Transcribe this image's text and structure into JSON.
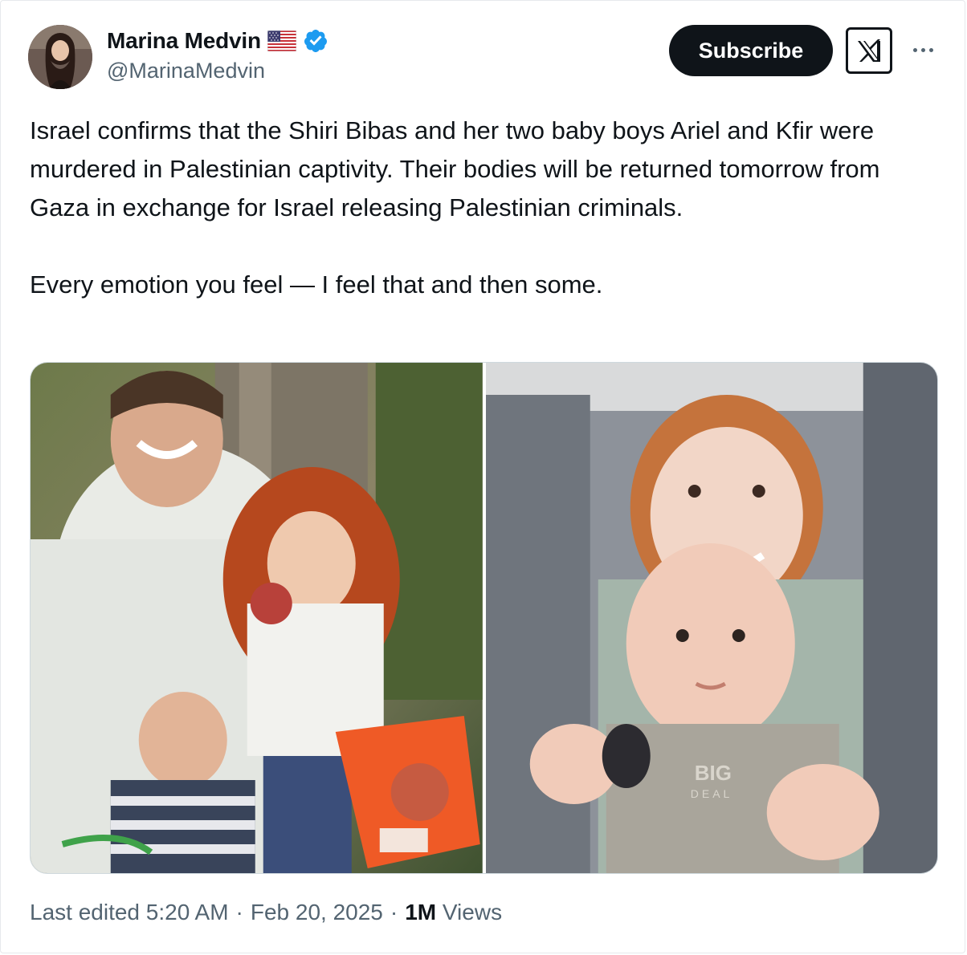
{
  "post": {
    "author": {
      "display_name": "Marina Medvin",
      "handle": "@MarinaMedvin",
      "flag": "us-flag-icon",
      "verified": true,
      "verified_color": "#1d9bf0"
    },
    "subscribe_label": "Subscribe",
    "text": "Israel confirms that the Shiri Bibas and her two baby boys Ariel and Kfir were murdered in Palestinian captivity. Their bodies will be returned tomorrow from Gaza in exchange for Israel releasing Palestinian criminals.\n\nEvery emotion you feel — I feel that and then some.",
    "media_count": 2,
    "timestamp": {
      "prefix": "Last edited",
      "time": "5:20 AM",
      "date": "Feb 20, 2025",
      "separator": "·"
    },
    "views": {
      "count": "1M",
      "label": "Views"
    }
  }
}
